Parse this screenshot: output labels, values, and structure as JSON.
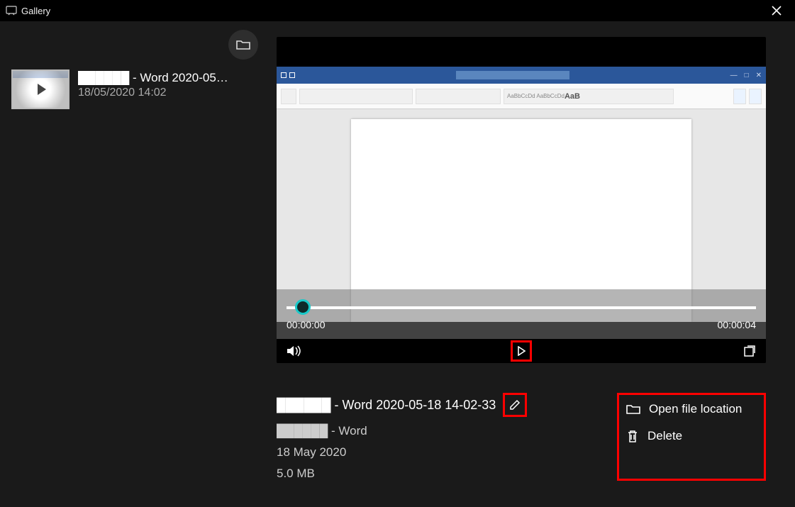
{
  "titlebar": {
    "title": "Gallery"
  },
  "sidebar": {
    "items": [
      {
        "label": "██████ - Word 2020-05…",
        "datetime": "18/05/2020 14:02"
      }
    ]
  },
  "player": {
    "current_time": "00:00:00",
    "duration": "00:00:04"
  },
  "details": {
    "filename": "██████ - Word 2020-05-18 14-02-33",
    "app": "██████ - Word",
    "date": "18 May 2020",
    "size": "5.0 MB"
  },
  "actions": {
    "open_location": "Open file location",
    "delete": "Delete"
  }
}
